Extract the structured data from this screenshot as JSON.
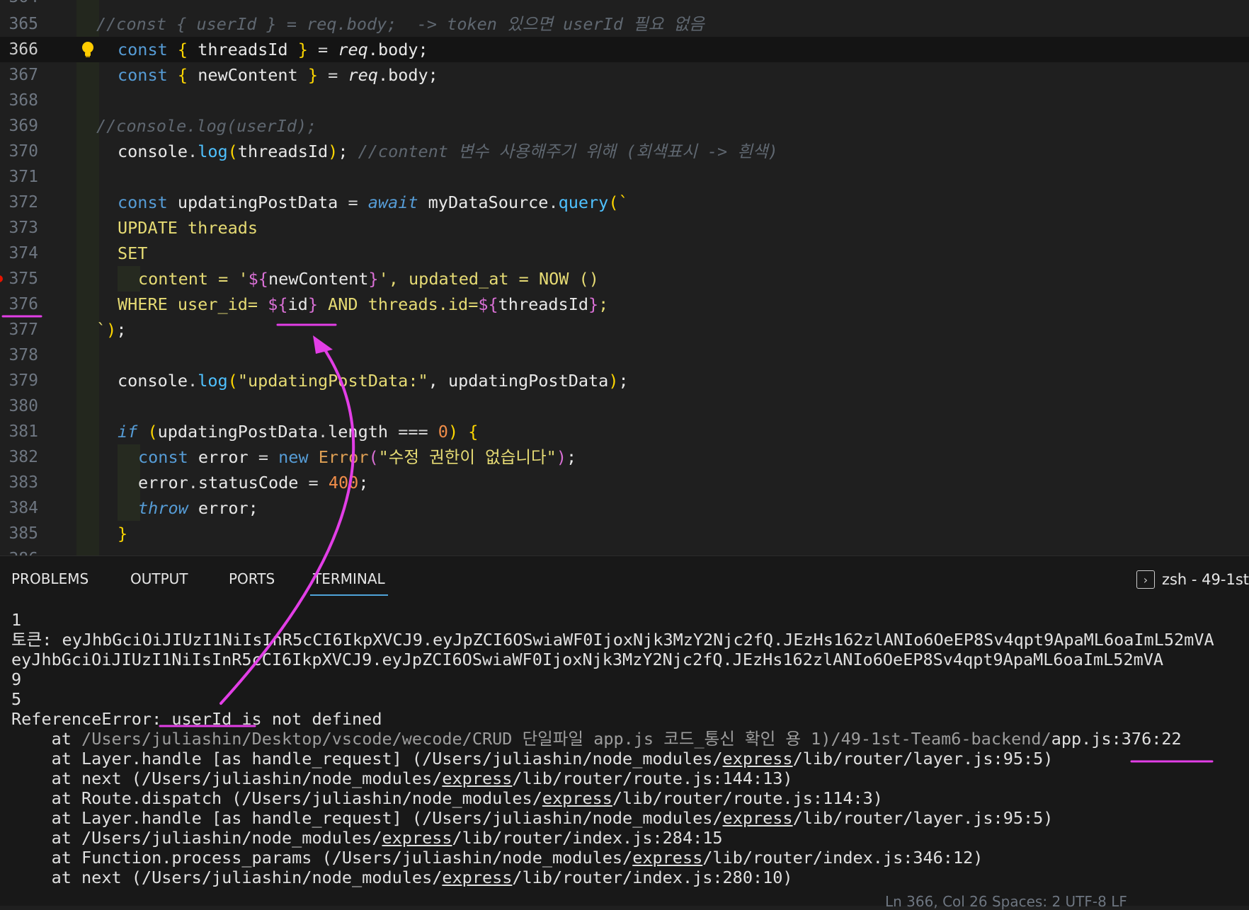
{
  "editor": {
    "partial_top_line_number": "364",
    "partial_bottom_line_number": "386",
    "lines": [
      {
        "n": "365",
        "comment": "//const { userId } = req.body;  -> token 있으면 userId 필요 없음"
      },
      {
        "n": "366",
        "t1": "const",
        "t2": "{",
        "t3": "threadsId",
        "t4": "}",
        "t5": "=",
        "t6": "req",
        "t7": ".body;"
      },
      {
        "n": "367",
        "t1": "const",
        "t2": "{",
        "t3": "newContent",
        "t4": "}",
        "t5": "=",
        "t6": "req",
        "t7": ".body;"
      },
      {
        "n": "368"
      },
      {
        "n": "369",
        "comment": "//console.log(userId);"
      },
      {
        "n": "370",
        "t1": "console",
        "t2": ".",
        "t3": "log",
        "t4": "(",
        "t5": "threadsId",
        "t6": ")",
        "t7": ";",
        "comment": "//content 변수 사용해주기 위해 (회색표시 -> 흰색)"
      },
      {
        "n": "371"
      },
      {
        "n": "372",
        "t1": "const",
        "t2": "updatingPostData",
        "t3": "=",
        "t4": "await",
        "t5": "myDataSource",
        "t6": ".",
        "t7": "query",
        "t8": "(`"
      },
      {
        "n": "373",
        "sql": "UPDATE threads"
      },
      {
        "n": "374",
        "sql": "SET"
      },
      {
        "n": "375",
        "sql1": "content = '",
        "d1": "${",
        "v1": "newContent",
        "d2": "}",
        "sql2": "', updated_at = NOW ()"
      },
      {
        "n": "376",
        "sql1": "WHERE user_id= ",
        "d1": "${",
        "v1": "id",
        "d2": "}",
        "sql2": " AND threads.id=",
        "d3": "${",
        "v2": "threadsId",
        "d4": "}",
        "sql3": ";"
      },
      {
        "n": "377",
        "t1": "`",
        "t2": ")",
        "t3": ";"
      },
      {
        "n": "378"
      },
      {
        "n": "379",
        "t1": "console",
        "t2": ".",
        "t3": "log",
        "t4": "(",
        "t5": "\"updatingPostData:\"",
        "t6": ",",
        "t7": "updatingPostData",
        "t8": ")",
        "t9": ";"
      },
      {
        "n": "380"
      },
      {
        "n": "381",
        "t1": "if",
        "t2": "(",
        "t3": "updatingPostData",
        "t4": ".",
        "t5": "length",
        "t6": "===",
        "t7": "0",
        "t8": ")",
        "t9": "{"
      },
      {
        "n": "382",
        "t1": "const",
        "t2": "error",
        "t3": "=",
        "t4": "new",
        "t5": "Error",
        "t6": "(",
        "t7": "\"수정 권한이 없습니다\"",
        "t8": ")",
        "t9": ";"
      },
      {
        "n": "383",
        "t1": "error",
        "t2": ".",
        "t3": "statusCode",
        "t4": "=",
        "t5": "400",
        "t6": ";"
      },
      {
        "n": "384",
        "t1": "throw",
        "t2": "error",
        "t3": ";"
      },
      {
        "n": "385",
        "t1": "}"
      }
    ]
  },
  "panel": {
    "tabs": [
      {
        "label": "PROBLEMS"
      },
      {
        "label": "OUTPUT"
      },
      {
        "label": "PORTS"
      },
      {
        "label": "TERMINAL"
      }
    ],
    "active_tab": "TERMINAL",
    "terminal_title": "zsh - 49-1st",
    "terminal_lines": {
      "l1": "1",
      "l2_prefix": "토큰: ",
      "l2_token": "eyJhbGciOiJIUzI1NiIsInR5cCI6IkpXVCJ9.eyJpZCI6OSwiaWF0IjoxNjk3MzY2Njc2fQ.JEzHs162zlANIo6OeEP8Sv4qpt9ApaML6oaImL52mVA",
      "l3": "eyJhbGciOiJIUzI1NiIsInR5cCI6IkpXVCJ9.eyJpZCI6OSwiaWF0IjoxNjk3MzY2Njc2fQ.JEzHs162zlANIo6OeEP8Sv4qpt9ApaML6oaImL52mVA",
      "l4": "9",
      "l5": "5",
      "l6": "ReferenceError: userId is not defined",
      "l7_at": "    at ",
      "l7_path": "/Users/juliashin/Desktop/vscode/wecode/CRUD 단일파일 app.js 코드_통신 확인 용 1)/49-1st-Team6-backend/",
      "l7_file": "app.js:376:22",
      "stack": [
        {
          "pre": "    at Layer.handle [as handle_request] (/Users/juliashin/node_modules/",
          "mod": "express",
          "post": "/lib/router/layer.js:95:5)"
        },
        {
          "pre": "    at next (/Users/juliashin/node_modules/",
          "mod": "express",
          "post": "/lib/router/route.js:144:13)"
        },
        {
          "pre": "    at Route.dispatch (/Users/juliashin/node_modules/",
          "mod": "express",
          "post": "/lib/router/route.js:114:3)"
        },
        {
          "pre": "    at Layer.handle [as handle_request] (/Users/juliashin/node_modules/",
          "mod": "express",
          "post": "/lib/router/layer.js:95:5)"
        },
        {
          "pre": "    at /Users/juliashin/node_modules/",
          "mod": "express",
          "post": "/lib/router/index.js:284:15"
        },
        {
          "pre": "    at Function.process_params (/Users/juliashin/node_modules/",
          "mod": "express",
          "post": "/lib/router/index.js:346:12)"
        },
        {
          "pre": "    at next (/Users/juliashin/node_modules/",
          "mod": "express",
          "post": "/lib/router/index.js:280:10)"
        }
      ]
    }
  },
  "status_bar": {
    "text": "Ln 366, Col 26   Spaces: 2   UTF-8   LF"
  },
  "colors": {
    "annotation": "#e23ee6",
    "accent": "#4fa3d9",
    "background": "#1f1f1f"
  }
}
